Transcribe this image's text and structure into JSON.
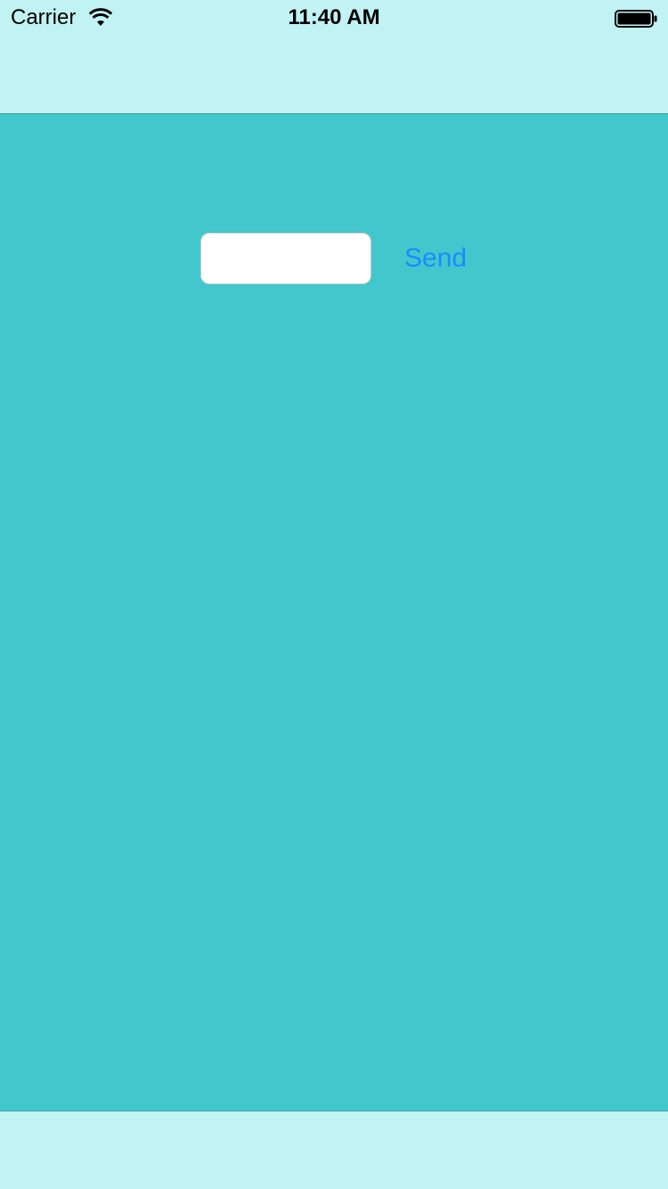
{
  "status_bar": {
    "carrier": "Carrier",
    "time": "11:40 AM",
    "wifi_icon": "wifi-icon",
    "battery_icon": "battery-icon",
    "battery_level": 1.0
  },
  "colors": {
    "bars_background": "#c1f2f4",
    "content_background": "#42c7cc",
    "accent": "#1a8cff",
    "field_background": "#ffffff"
  },
  "form": {
    "input_value": "",
    "input_placeholder": "",
    "send_label": "Send"
  }
}
